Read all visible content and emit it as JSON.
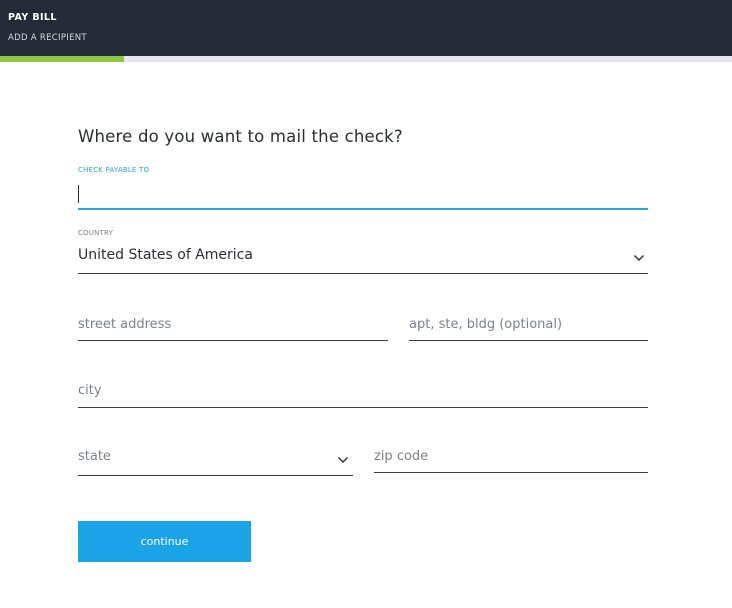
{
  "header": {
    "title": "PAY BILL",
    "subtitle": "ADD A RECIPIENT",
    "progress_fraction": 0.17
  },
  "form": {
    "heading": "Where do you want to mail the check?",
    "payable_label": "CHECK PAYABLE TO",
    "payable_value": "",
    "country_label": "COUNTRY",
    "country_value": "United States of America",
    "street_placeholder": "street address",
    "apt_placeholder": "apt, ste, bldg (optional)",
    "city_placeholder": "city",
    "state_placeholder": "state",
    "zip_placeholder": "zip code",
    "continue_label": "continue"
  },
  "icons": {
    "country_dropdown": "chevron-down-icon",
    "state_dropdown": "chevron-down-icon"
  },
  "colors": {
    "header_bg": "#242a37",
    "progress_fill": "#8dc63f",
    "accent": "#29a4e0",
    "button_bg": "#1ba3e8"
  }
}
